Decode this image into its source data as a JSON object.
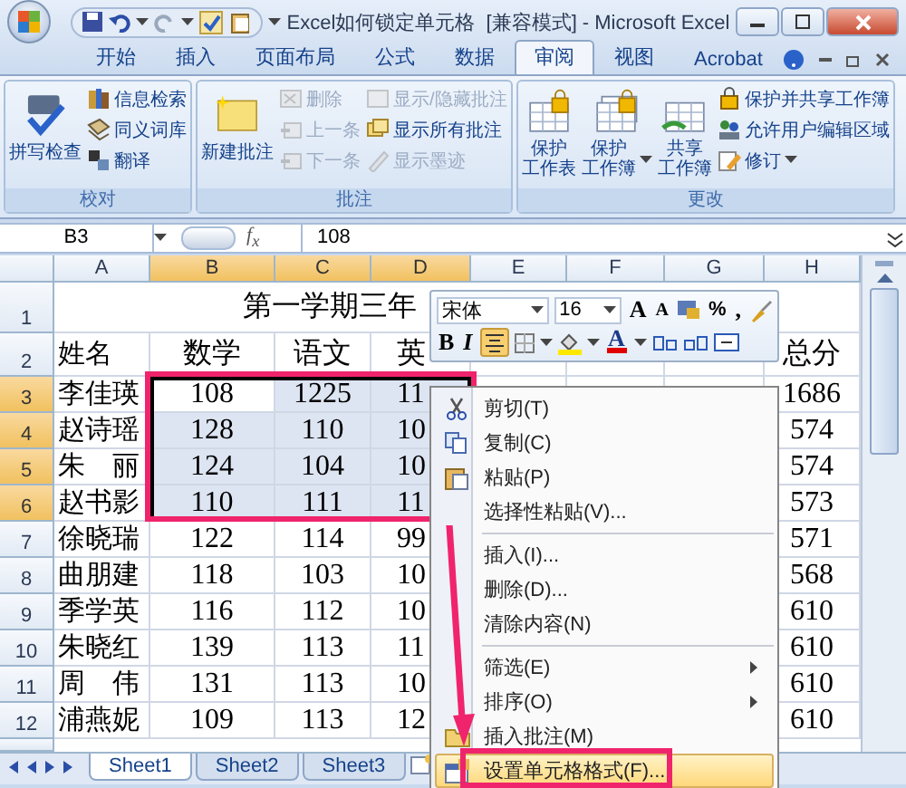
{
  "window": {
    "title": "Excel如何锁定单元格  [兼容模式] - Microsoft Excel"
  },
  "ribbon_tabs": [
    {
      "label": "开始",
      "selected": false
    },
    {
      "label": "插入",
      "selected": false
    },
    {
      "label": "页面布局",
      "selected": false
    },
    {
      "label": "公式",
      "selected": false
    },
    {
      "label": "数据",
      "selected": false
    },
    {
      "label": "审阅",
      "selected": true
    },
    {
      "label": "视图",
      "selected": false
    },
    {
      "label": "Acrobat",
      "selected": false
    }
  ],
  "ribbon_groups": [
    {
      "label": "校对",
      "large": [
        {
          "lines": [
            "拼写检查"
          ],
          "kind": "spell",
          "dropdown": false
        }
      ],
      "small_columns": [
        [
          {
            "label": "信息检索",
            "kind": "research",
            "disabled": false,
            "dropdown": false
          },
          {
            "label": "同义词库",
            "kind": "thesaurus",
            "disabled": false,
            "dropdown": false
          },
          {
            "label": "翻译",
            "kind": "translate",
            "disabled": false,
            "dropdown": false
          }
        ]
      ]
    },
    {
      "label": "批注",
      "large": [
        {
          "lines": [
            "新建批注"
          ],
          "kind": "new_comment",
          "dropdown": false
        }
      ],
      "small_columns": [
        [
          {
            "label": "删除",
            "kind": "delete",
            "disabled": true,
            "dropdown": false
          },
          {
            "label": "上一条",
            "kind": "prev",
            "disabled": true,
            "dropdown": false
          },
          {
            "label": "下一条",
            "kind": "next",
            "disabled": true,
            "dropdown": false
          }
        ],
        [
          {
            "label": "显示/隐藏批注",
            "kind": "show_hide",
            "disabled": true,
            "dropdown": false
          },
          {
            "label": "显示所有批注",
            "kind": "show_all",
            "disabled": false,
            "dropdown": false
          },
          {
            "label": "显示墨迹",
            "kind": "ink",
            "disabled": true,
            "dropdown": false
          }
        ]
      ]
    },
    {
      "label": "更改",
      "large": [
        {
          "lines": [
            "保护",
            "工作表"
          ],
          "kind": "protect_sheet",
          "dropdown": false
        },
        {
          "lines": [
            "保护",
            "工作簿"
          ],
          "kind": "protect_book",
          "dropdown": true
        },
        {
          "lines": [
            "共享",
            "工作簿"
          ],
          "kind": "share_book",
          "dropdown": false
        }
      ],
      "small_columns": [
        [
          {
            "label": "保护并共享工作簿",
            "kind": "protect_share",
            "disabled": false,
            "dropdown": false
          },
          {
            "label": "允许用户编辑区域",
            "kind": "allow_edit",
            "disabled": false,
            "dropdown": false
          },
          {
            "label": "修订",
            "kind": "track",
            "disabled": false,
            "dropdown": true
          }
        ]
      ]
    }
  ],
  "formula_bar": {
    "name_box": "B3",
    "function_label": "f$_{x}$",
    "formula": "108"
  },
  "sheet": {
    "columns": [
      {
        "label": "A",
        "selected": false
      },
      {
        "label": "B",
        "selected": true
      },
      {
        "label": "C",
        "selected": true
      },
      {
        "label": "D",
        "selected": true
      },
      {
        "label": "E",
        "selected": false
      },
      {
        "label": "F",
        "selected": false
      },
      {
        "label": "G",
        "selected": false
      },
      {
        "label": "H",
        "selected": false
      }
    ],
    "rows": [
      {
        "header": "1",
        "selected": false,
        "title": "第一学期三年"
      },
      {
        "header": "2",
        "selected": false,
        "cells": [
          "姓名",
          "数学",
          "语文",
          "英",
          null,
          null,
          null,
          "总分"
        ]
      },
      {
        "header": "3",
        "selected": true,
        "cells": [
          "李佳瑛",
          "108",
          "1225",
          "11",
          null,
          null,
          null,
          "1686"
        ]
      },
      {
        "header": "4",
        "selected": true,
        "cells": [
          "赵诗瑶",
          "128",
          "110",
          "10",
          null,
          null,
          null,
          "574"
        ]
      },
      {
        "header": "5",
        "selected": true,
        "cells": [
          "朱　丽",
          "124",
          "104",
          "10",
          null,
          null,
          null,
          "574"
        ]
      },
      {
        "header": "6",
        "selected": true,
        "cells": [
          "赵书影",
          "110",
          "111",
          "11",
          null,
          null,
          null,
          "573"
        ]
      },
      {
        "header": "7",
        "selected": false,
        "cells": [
          "徐晓瑞",
          "122",
          "114",
          "99",
          null,
          null,
          null,
          "571"
        ]
      },
      {
        "header": "8",
        "selected": false,
        "cells": [
          "曲朋建",
          "118",
          "103",
          "10",
          null,
          null,
          null,
          "568"
        ]
      },
      {
        "header": "9",
        "selected": false,
        "cells": [
          "季学英",
          "116",
          "112",
          "10",
          null,
          null,
          null,
          "610"
        ]
      },
      {
        "header": "10",
        "selected": false,
        "cells": [
          "朱晓红",
          "139",
          "113",
          "11",
          null,
          null,
          null,
          "610"
        ]
      },
      {
        "header": "11",
        "selected": false,
        "cells": [
          "周　伟",
          "131",
          "113",
          "10",
          null,
          null,
          null,
          "610"
        ]
      },
      {
        "header": "12",
        "selected": false,
        "cells": [
          "浦燕妮",
          "109",
          "113",
          "12",
          null,
          null,
          null,
          "610"
        ]
      }
    ]
  },
  "mini_toolbar": {
    "font": "宋体",
    "size": "16",
    "grow": "A",
    "shrink": "A",
    "percent": "%",
    "comma": ",",
    "bold": "B",
    "italic": "I",
    "font_color": "A",
    "center_selected": true
  },
  "context_menu": [
    {
      "kind": "item",
      "label": "剪切(T)",
      "submenu": false,
      "selected": false
    },
    {
      "kind": "item",
      "label": "复制(C)",
      "submenu": false,
      "selected": false
    },
    {
      "kind": "item",
      "label": "粘贴(P)",
      "submenu": false,
      "selected": false
    },
    {
      "kind": "item",
      "label": "选择性粘贴(V)...",
      "submenu": false,
      "selected": false
    },
    {
      "kind": "separator"
    },
    {
      "kind": "item",
      "label": "插入(I)...",
      "submenu": false,
      "selected": false
    },
    {
      "kind": "item",
      "label": "删除(D)...",
      "submenu": false,
      "selected": false
    },
    {
      "kind": "item",
      "label": "清除内容(N)",
      "submenu": false,
      "selected": false
    },
    {
      "kind": "separator"
    },
    {
      "kind": "item",
      "label": "筛选(E)",
      "submenu": true,
      "selected": false
    },
    {
      "kind": "item",
      "label": "排序(O)",
      "submenu": true,
      "selected": false
    },
    {
      "kind": "item",
      "label": "插入批注(M)",
      "submenu": false,
      "selected": false
    },
    {
      "kind": "item",
      "label": "设置单元格格式(F)...",
      "submenu": false,
      "selected": true
    }
  ],
  "sheet_tabs": [
    {
      "label": "Sheet1",
      "selected": true
    },
    {
      "label": "Sheet2",
      "selected": false
    },
    {
      "label": "Sheet3",
      "selected": false
    }
  ]
}
